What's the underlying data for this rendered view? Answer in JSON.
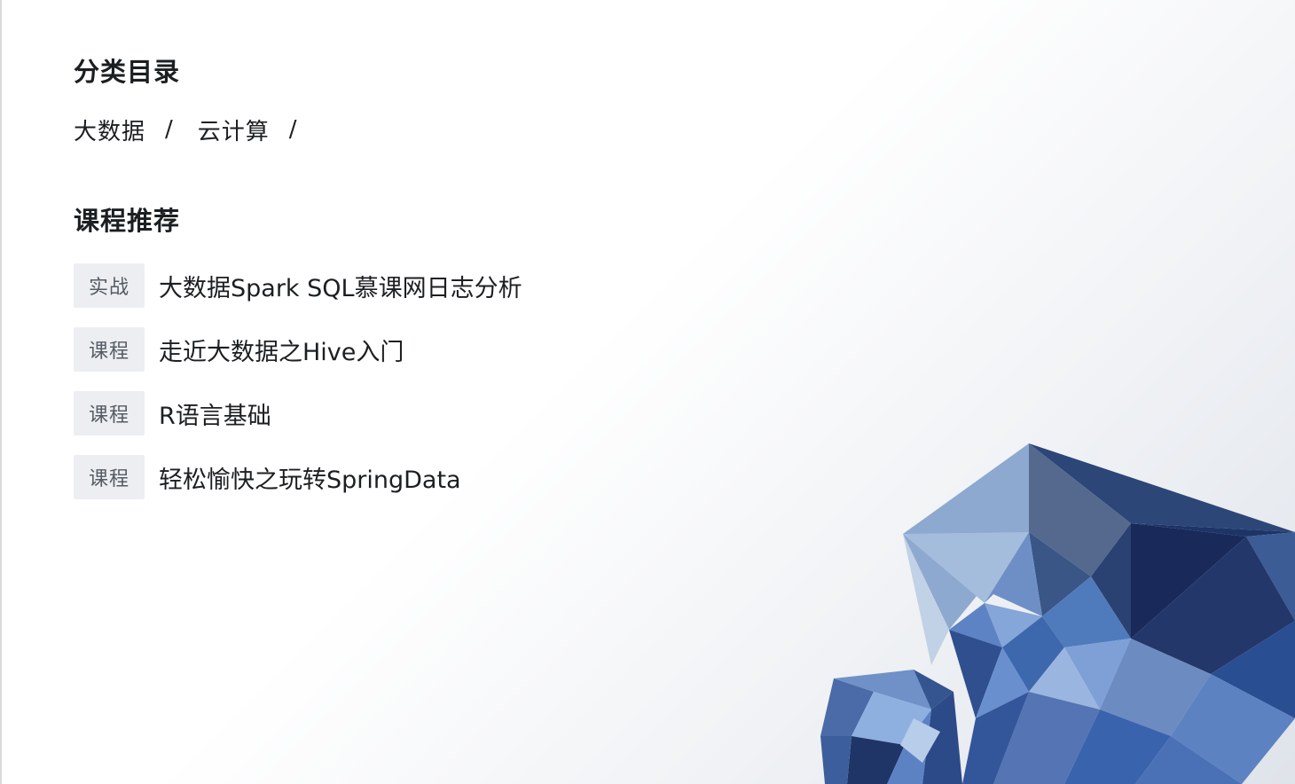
{
  "catalog": {
    "title": "分类目录",
    "items": [
      "大数据",
      "云计算"
    ],
    "separator": "/"
  },
  "recommend": {
    "title": "课程推荐",
    "courses": [
      {
        "badge": "实战",
        "title": "大数据Spark SQL慕课网日志分析"
      },
      {
        "badge": "课程",
        "title": "走近大数据之Hive入门"
      },
      {
        "badge": "课程",
        "title": "R语言基础"
      },
      {
        "badge": "课程",
        "title": "轻松愉快之玩转SpringData"
      }
    ]
  },
  "decoration": {
    "illustration": "low-poly-crystal-icon",
    "colors": {
      "badge_bg": "#eceef1",
      "badge_text": "#545c63",
      "text": "#1c1f21",
      "crystal_dark": "#1b2a4e",
      "crystal_mid": "#4f79b7",
      "crystal_light": "#9cb6d8"
    }
  }
}
